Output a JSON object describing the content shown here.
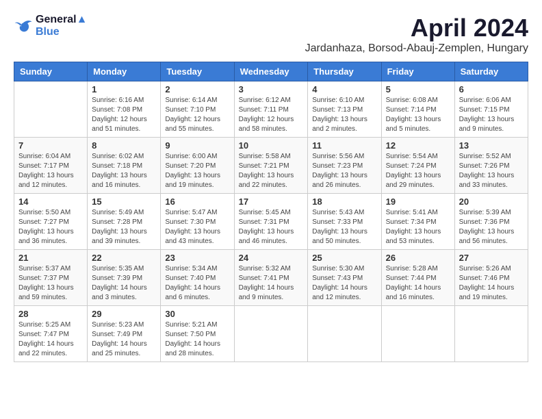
{
  "header": {
    "logo_line1": "General",
    "logo_line2": "Blue",
    "month_title": "April 2024",
    "subtitle": "Jardanhaza, Borsod-Abauj-Zemplen, Hungary"
  },
  "days_of_week": [
    "Sunday",
    "Monday",
    "Tuesday",
    "Wednesday",
    "Thursday",
    "Friday",
    "Saturday"
  ],
  "weeks": [
    [
      {
        "day": "",
        "info": ""
      },
      {
        "day": "1",
        "info": "Sunrise: 6:16 AM\nSunset: 7:08 PM\nDaylight: 12 hours\nand 51 minutes."
      },
      {
        "day": "2",
        "info": "Sunrise: 6:14 AM\nSunset: 7:10 PM\nDaylight: 12 hours\nand 55 minutes."
      },
      {
        "day": "3",
        "info": "Sunrise: 6:12 AM\nSunset: 7:11 PM\nDaylight: 12 hours\nand 58 minutes."
      },
      {
        "day": "4",
        "info": "Sunrise: 6:10 AM\nSunset: 7:13 PM\nDaylight: 13 hours\nand 2 minutes."
      },
      {
        "day": "5",
        "info": "Sunrise: 6:08 AM\nSunset: 7:14 PM\nDaylight: 13 hours\nand 5 minutes."
      },
      {
        "day": "6",
        "info": "Sunrise: 6:06 AM\nSunset: 7:15 PM\nDaylight: 13 hours\nand 9 minutes."
      }
    ],
    [
      {
        "day": "7",
        "info": "Sunrise: 6:04 AM\nSunset: 7:17 PM\nDaylight: 13 hours\nand 12 minutes."
      },
      {
        "day": "8",
        "info": "Sunrise: 6:02 AM\nSunset: 7:18 PM\nDaylight: 13 hours\nand 16 minutes."
      },
      {
        "day": "9",
        "info": "Sunrise: 6:00 AM\nSunset: 7:20 PM\nDaylight: 13 hours\nand 19 minutes."
      },
      {
        "day": "10",
        "info": "Sunrise: 5:58 AM\nSunset: 7:21 PM\nDaylight: 13 hours\nand 22 minutes."
      },
      {
        "day": "11",
        "info": "Sunrise: 5:56 AM\nSunset: 7:23 PM\nDaylight: 13 hours\nand 26 minutes."
      },
      {
        "day": "12",
        "info": "Sunrise: 5:54 AM\nSunset: 7:24 PM\nDaylight: 13 hours\nand 29 minutes."
      },
      {
        "day": "13",
        "info": "Sunrise: 5:52 AM\nSunset: 7:26 PM\nDaylight: 13 hours\nand 33 minutes."
      }
    ],
    [
      {
        "day": "14",
        "info": "Sunrise: 5:50 AM\nSunset: 7:27 PM\nDaylight: 13 hours\nand 36 minutes."
      },
      {
        "day": "15",
        "info": "Sunrise: 5:49 AM\nSunset: 7:28 PM\nDaylight: 13 hours\nand 39 minutes."
      },
      {
        "day": "16",
        "info": "Sunrise: 5:47 AM\nSunset: 7:30 PM\nDaylight: 13 hours\nand 43 minutes."
      },
      {
        "day": "17",
        "info": "Sunrise: 5:45 AM\nSunset: 7:31 PM\nDaylight: 13 hours\nand 46 minutes."
      },
      {
        "day": "18",
        "info": "Sunrise: 5:43 AM\nSunset: 7:33 PM\nDaylight: 13 hours\nand 50 minutes."
      },
      {
        "day": "19",
        "info": "Sunrise: 5:41 AM\nSunset: 7:34 PM\nDaylight: 13 hours\nand 53 minutes."
      },
      {
        "day": "20",
        "info": "Sunrise: 5:39 AM\nSunset: 7:36 PM\nDaylight: 13 hours\nand 56 minutes."
      }
    ],
    [
      {
        "day": "21",
        "info": "Sunrise: 5:37 AM\nSunset: 7:37 PM\nDaylight: 13 hours\nand 59 minutes."
      },
      {
        "day": "22",
        "info": "Sunrise: 5:35 AM\nSunset: 7:39 PM\nDaylight: 14 hours\nand 3 minutes."
      },
      {
        "day": "23",
        "info": "Sunrise: 5:34 AM\nSunset: 7:40 PM\nDaylight: 14 hours\nand 6 minutes."
      },
      {
        "day": "24",
        "info": "Sunrise: 5:32 AM\nSunset: 7:41 PM\nDaylight: 14 hours\nand 9 minutes."
      },
      {
        "day": "25",
        "info": "Sunrise: 5:30 AM\nSunset: 7:43 PM\nDaylight: 14 hours\nand 12 minutes."
      },
      {
        "day": "26",
        "info": "Sunrise: 5:28 AM\nSunset: 7:44 PM\nDaylight: 14 hours\nand 16 minutes."
      },
      {
        "day": "27",
        "info": "Sunrise: 5:26 AM\nSunset: 7:46 PM\nDaylight: 14 hours\nand 19 minutes."
      }
    ],
    [
      {
        "day": "28",
        "info": "Sunrise: 5:25 AM\nSunset: 7:47 PM\nDaylight: 14 hours\nand 22 minutes."
      },
      {
        "day": "29",
        "info": "Sunrise: 5:23 AM\nSunset: 7:49 PM\nDaylight: 14 hours\nand 25 minutes."
      },
      {
        "day": "30",
        "info": "Sunrise: 5:21 AM\nSunset: 7:50 PM\nDaylight: 14 hours\nand 28 minutes."
      },
      {
        "day": "",
        "info": ""
      },
      {
        "day": "",
        "info": ""
      },
      {
        "day": "",
        "info": ""
      },
      {
        "day": "",
        "info": ""
      }
    ]
  ]
}
